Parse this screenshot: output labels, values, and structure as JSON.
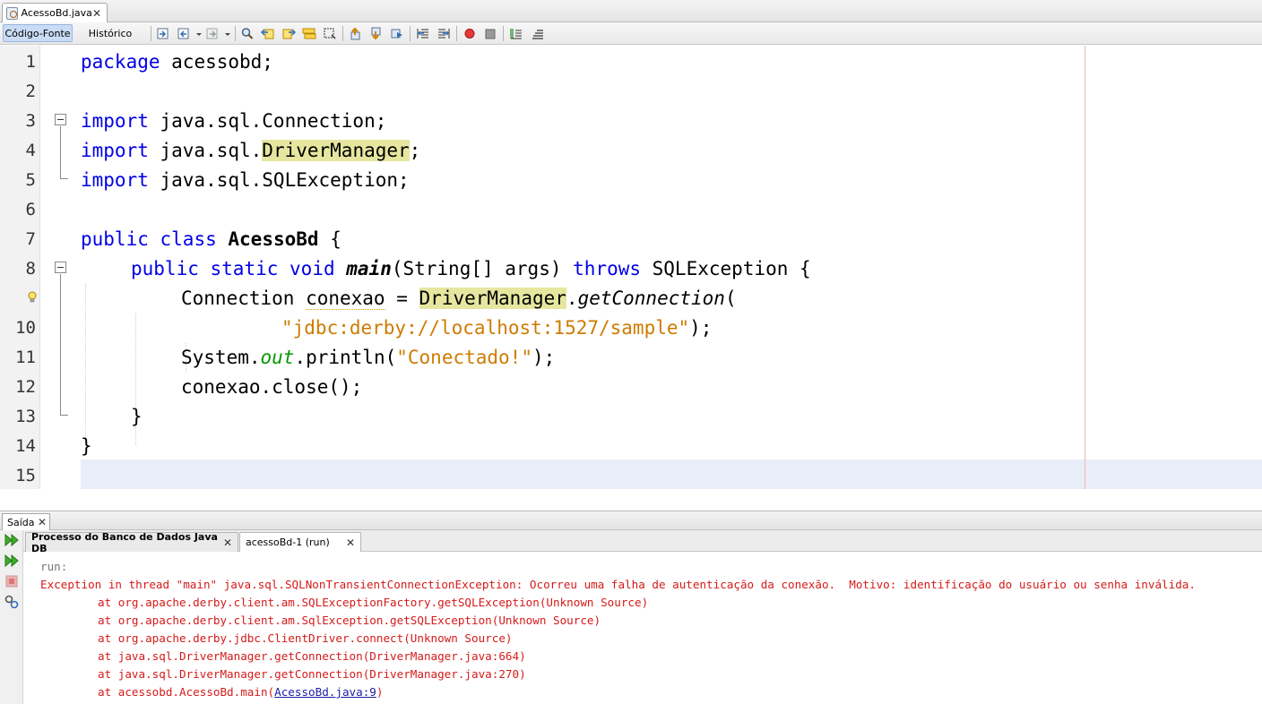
{
  "file_tab": {
    "title": "AcessoBd.java",
    "close": "✕"
  },
  "toolbar": {
    "source_label": "Código-Fonte",
    "history_label": "Histórico"
  },
  "editor": {
    "line_numbers": [
      "1",
      "2",
      "3",
      "4",
      "5",
      "6",
      "7",
      "8",
      "9",
      "10",
      "11",
      "12",
      "13",
      "14",
      "15"
    ],
    "code": {
      "package_kw": "package",
      "package_name": " acessobd;",
      "import_kw": "import",
      "import1": " java.sql.Connection;",
      "import2_pre": " java.sql.",
      "import2_cls": "DriverManager",
      "import2_post": ";",
      "import3": " java.sql.SQLException;",
      "public_kw": "public",
      "class_kw": "class",
      "class_name": "AcessoBd",
      "class_open": " {",
      "static_kw": "static",
      "void_kw": "void",
      "main_name": "main",
      "main_args": "(String[] args) ",
      "throws_kw": "throws",
      "main_tail": " SQLException {",
      "l9_type": "Connection ",
      "l9_var": "conexao",
      "l9_eq": " = ",
      "l9_dm": "DriverManager",
      "l9_dot": ".",
      "l9_method": "getConnection",
      "l9_paren": "(",
      "l10_str": "\"jdbc:derby://localhost:1527/sample\"",
      "l10_end": ");",
      "l11_sys": "System.",
      "l11_out": "out",
      "l11_print": ".println(",
      "l11_str": "\"Conectado!\"",
      "l11_end": ");",
      "l12": "conexao.close();",
      "l13": "}",
      "l14": "}"
    }
  },
  "output": {
    "panel_title": "Saída",
    "tabs": [
      {
        "label": "Processo do Banco de Dados Java DB"
      },
      {
        "label": "acessoBd-1 (run)"
      }
    ],
    "run": "run:",
    "exception": "Exception in thread \"main\" java.sql.SQLNonTransientConnectionException: Ocorreu uma falha de autenticação da conexão.  Motivo: identificação do usuário ou senha inválida.",
    "trace": [
      "at org.apache.derby.client.am.SQLExceptionFactory.getSQLException(Unknown Source)",
      "at org.apache.derby.client.am.SqlException.getSQLException(Unknown Source)",
      "at org.apache.derby.jdbc.ClientDriver.connect(Unknown Source)",
      "at java.sql.DriverManager.getConnection(DriverManager.java:664)",
      "at java.sql.DriverManager.getConnection(DriverManager.java:270)"
    ],
    "last_trace_prefix": "at acessobd.AcessoBd.main(",
    "last_trace_link": "AcessoBd.java:9",
    "last_trace_suffix": ")"
  }
}
